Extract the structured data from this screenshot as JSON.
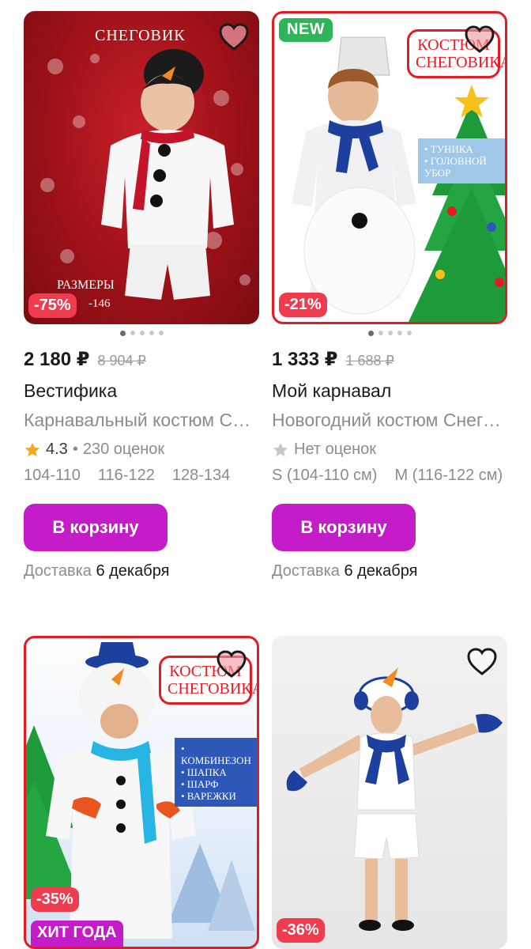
{
  "products": [
    {
      "image_caption": "СНЕГОВИК",
      "image_sizes_label": "РАЗМЕРЫ",
      "image_sizes_value": "-146",
      "discount": "-75%",
      "price": "2 180 ₽",
      "old_price": "8 904 ₽",
      "brand": "Вестифика",
      "title": "Карнавальный костюм Снеговик",
      "rating": "4.3",
      "reviews": "230 оценок",
      "sizes": [
        "104-110",
        "116-122",
        "128-134"
      ],
      "cart_label": "В корзину",
      "delivery_prefix": "Доставка",
      "delivery_date": "6 декабря"
    },
    {
      "badge": "NEW",
      "image_banner": "КОСТЮМ СНЕГОВИКА",
      "image_list": [
        "• ТУНИКА",
        "• ГОЛОВНОЙ УБОР"
      ],
      "discount": "-21%",
      "price": "1 333 ₽",
      "old_price": "1 688 ₽",
      "brand": "Мой карнавал",
      "title": "Новогодний костюм Снеговик",
      "rating_text": "Нет оценок",
      "sizes": [
        "S (104-110 см)",
        "M (116-122 см)"
      ],
      "cart_label": "В корзину",
      "delivery_prefix": "Доставка",
      "delivery_date": "6 декабря"
    },
    {
      "image_banner": "КОСТЮМ СНЕГОВИКА",
      "image_list": [
        "• КОМБИНЕЗОН",
        "• ШАПКА",
        "• ШАРФ",
        "• ВАРЕЖКИ"
      ],
      "discount": "-35%",
      "hit": "ХИТ ГОДА"
    },
    {
      "discount": "-36%"
    }
  ],
  "colors": {
    "accent": "#c31cc8",
    "discount": "#ef3b4e",
    "new": "#2fb45a"
  }
}
